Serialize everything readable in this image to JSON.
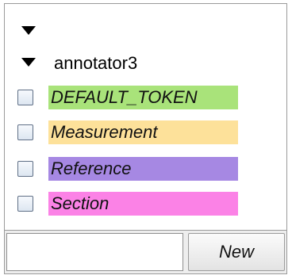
{
  "tree": {
    "root_label": "",
    "annotator": {
      "label": "annotator3",
      "items": [
        {
          "label": "DEFAULT_TOKEN",
          "color": "#a9e37a",
          "checked": false
        },
        {
          "label": "Measurement",
          "color": "#fde19a",
          "checked": false
        },
        {
          "label": "Reference",
          "color": "#a688e3",
          "checked": false
        },
        {
          "label": "Section",
          "color": "#fb82e6",
          "checked": false
        }
      ]
    }
  },
  "bottom": {
    "input_value": "",
    "new_button_label": "New"
  }
}
